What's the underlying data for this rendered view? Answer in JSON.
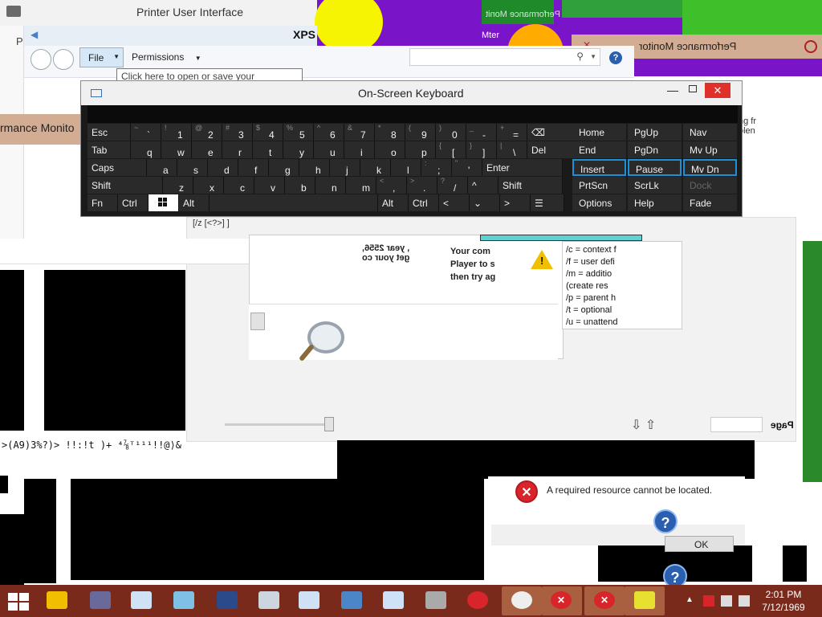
{
  "printer_window": {
    "title": "Printer User Interface",
    "side_char": "P"
  },
  "xps": {
    "title_fragment": "XPS",
    "menu": {
      "file": "File",
      "permissions": "Permissions"
    },
    "tooltip": "Click here to open or save your document",
    "search_placeholder": ""
  },
  "perf_monitor": {
    "title": "Performance Monitor",
    "left_fragment": "rmance Monito"
  },
  "glitch_texts": [
    "Performance Monit",
    "Mter"
  ],
  "osk": {
    "title": "On-Screen Keyboard",
    "rows": [
      [
        {
          "label": "Esc",
          "w": 54
        },
        {
          "shift": "~",
          "base": "`",
          "w": 38
        },
        {
          "shift": "!",
          "base": "1",
          "w": 38
        },
        {
          "shift": "@",
          "base": "2",
          "w": 38
        },
        {
          "shift": "#",
          "base": "3",
          "w": 38
        },
        {
          "shift": "$",
          "base": "4",
          "w": 38
        },
        {
          "shift": "%",
          "base": "5",
          "w": 38
        },
        {
          "shift": "^",
          "base": "6",
          "w": 38
        },
        {
          "shift": "&",
          "base": "7",
          "w": 38
        },
        {
          "shift": "*",
          "base": "8",
          "w": 38
        },
        {
          "shift": "(",
          "base": "9",
          "w": 38
        },
        {
          "shift": ")",
          "base": "0",
          "w": 38
        },
        {
          "shift": "_",
          "base": "-",
          "w": 38
        },
        {
          "shift": "+",
          "base": "=",
          "w": 38
        },
        {
          "label": "⌫",
          "w": 60
        }
      ],
      [
        {
          "label": "Tab",
          "w": 54
        },
        {
          "base": "q",
          "w": 38
        },
        {
          "base": "w",
          "w": 38
        },
        {
          "base": "e",
          "w": 38
        },
        {
          "base": "r",
          "w": 38
        },
        {
          "base": "t",
          "w": 38
        },
        {
          "base": "y",
          "w": 38
        },
        {
          "base": "u",
          "w": 38
        },
        {
          "base": "i",
          "w": 38
        },
        {
          "base": "o",
          "w": 38
        },
        {
          "base": "p",
          "w": 38
        },
        {
          "shift": "{",
          "base": "[",
          "w": 38
        },
        {
          "shift": "}",
          "base": "]",
          "w": 38
        },
        {
          "shift": "|",
          "base": "\\",
          "w": 38
        },
        {
          "label": "Del",
          "w": 60
        }
      ],
      [
        {
          "label": "Caps",
          "w": 74
        },
        {
          "base": "a",
          "w": 38
        },
        {
          "base": "s",
          "w": 38
        },
        {
          "base": "d",
          "w": 38
        },
        {
          "base": "f",
          "w": 38
        },
        {
          "base": "g",
          "w": 38
        },
        {
          "base": "h",
          "w": 38
        },
        {
          "base": "j",
          "w": 38
        },
        {
          "base": "k",
          "w": 38
        },
        {
          "base": "l",
          "w": 38
        },
        {
          "shift": ":",
          "base": ";",
          "w": 38
        },
        {
          "shift": "\"",
          "base": "'",
          "w": 38
        },
        {
          "label": "Enter",
          "w": 100
        }
      ],
      [
        {
          "label": "Shift",
          "w": 94
        },
        {
          "base": "z",
          "w": 38
        },
        {
          "base": "x",
          "w": 38
        },
        {
          "base": "c",
          "w": 38
        },
        {
          "base": "v",
          "w": 38
        },
        {
          "base": "b",
          "w": 38
        },
        {
          "base": "n",
          "w": 38
        },
        {
          "base": "m",
          "w": 38
        },
        {
          "shift": "<",
          "base": ",",
          "w": 38
        },
        {
          "shift": ">",
          "base": ".",
          "w": 38
        },
        {
          "shift": "?",
          "base": "/",
          "w": 38
        },
        {
          "label": "^",
          "w": 38
        },
        {
          "label": "Shift",
          "w": 80
        }
      ],
      [
        {
          "label": "Fn",
          "w": 38
        },
        {
          "label": "Ctrl",
          "w": 38
        },
        {
          "label": "WIN",
          "w": 38
        },
        {
          "label": "Alt",
          "w": 38
        },
        {
          "label": "",
          "w": 210
        },
        {
          "label": "Alt",
          "w": 38
        },
        {
          "label": "Ctrl",
          "w": 38
        },
        {
          "label": "<",
          "w": 38
        },
        {
          "label": "⌄",
          "w": 38
        },
        {
          "label": ">",
          "w": 38
        },
        {
          "label": "☰",
          "w": 42
        }
      ]
    ],
    "nav": [
      [
        "Home",
        "PgUp",
        "Nav"
      ],
      [
        "End",
        "PgDn",
        "Mv Up"
      ],
      [
        "Insert",
        "Pause",
        "Mv Dn"
      ],
      [
        "PrtScn",
        "ScrLk",
        "Dock"
      ],
      [
        "Options",
        "Help",
        "Fade"
      ]
    ]
  },
  "document": {
    "message_lines": [
      "Your com",
      "Player to s",
      "then try ag"
    ],
    "mirror_lines": [
      ", year 2556,",
      "get your co"
    ],
    "bracket_text": "[/z [<?>] ]",
    "cmd_lines": [
      "/c = context f",
      "/f = user defi",
      "/m = additio",
      "(create res",
      "/p = parent h",
      "/t = optional",
      "/u = unattend"
    ],
    "right_lines": [
      "ng fr",
      "olen"
    ],
    "page_label": "Page"
  },
  "gibberish": ">(A9)3%?)> !!:!t )+ ⁴⅞ᵀ¹¹¹!!@⟩&",
  "error_dialog": {
    "message": "A required resource cannot be located.",
    "ok_label": "OK"
  },
  "taskbar": {
    "time": "2:01 PM",
    "date": "7/12/1969",
    "accent_color": "#7a2a1a"
  }
}
